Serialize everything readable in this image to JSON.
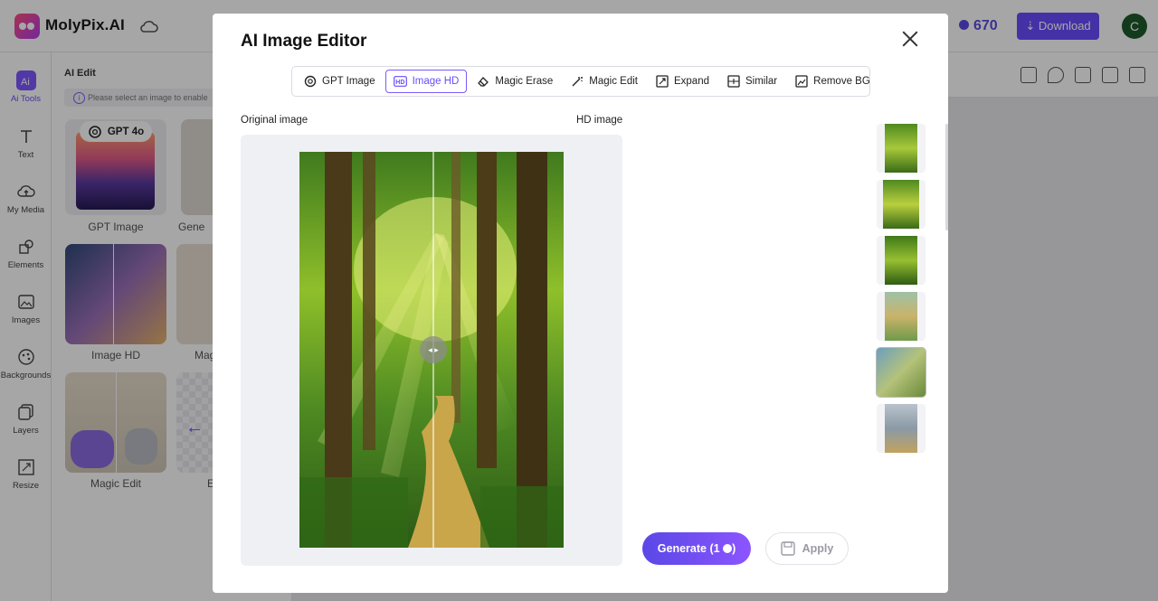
{
  "app": {
    "brand": "MolyPix.AI",
    "credits": "670",
    "download_label": "Download",
    "avatar_initial": "C"
  },
  "rail": {
    "items": [
      {
        "label": "Ai Tools",
        "icon": "ai-sparkle-icon"
      },
      {
        "label": "Text",
        "icon": "text-icon"
      },
      {
        "label": "My Media",
        "icon": "upload-cloud-icon"
      },
      {
        "label": "Elements",
        "icon": "shapes-icon"
      },
      {
        "label": "Images",
        "icon": "image-icon"
      },
      {
        "label": "Backgrounds",
        "icon": "palette-icon"
      },
      {
        "label": "Layers",
        "icon": "layers-icon"
      },
      {
        "label": "Resize",
        "icon": "resize-icon"
      }
    ]
  },
  "panel": {
    "title": "AI Edit",
    "note": "Please select an image to enable",
    "badge": "GPT 4o",
    "tiles": [
      "GPT Image",
      "Gene",
      "Image HD",
      "Mag",
      "Magic Edit",
      "E"
    ]
  },
  "modal": {
    "title": "AI Image Editor",
    "tabs": [
      {
        "label": "GPT Image",
        "icon": "openai-icon",
        "active": false
      },
      {
        "label": "Image HD",
        "icon": "hd-icon",
        "active": true
      },
      {
        "label": "Magic Erase",
        "icon": "eraser-icon",
        "active": false
      },
      {
        "label": "Magic Edit",
        "icon": "magic-wand-icon",
        "active": false
      },
      {
        "label": "Expand",
        "icon": "expand-icon",
        "active": false
      },
      {
        "label": "Similar",
        "icon": "similar-icon",
        "active": false
      },
      {
        "label": "Remove BG",
        "icon": "remove-bg-icon",
        "active": false
      }
    ],
    "original_label": "Original image",
    "hd_label": "HD image",
    "generate_label": "Generate",
    "generate_cost": "(1",
    "generate_cost_end": ")",
    "apply_label": "Apply"
  },
  "colors": {
    "accent": "#6a4cff",
    "credits": "#5b4ae0",
    "overlay": "rgba(0,0,0,0.35)"
  }
}
